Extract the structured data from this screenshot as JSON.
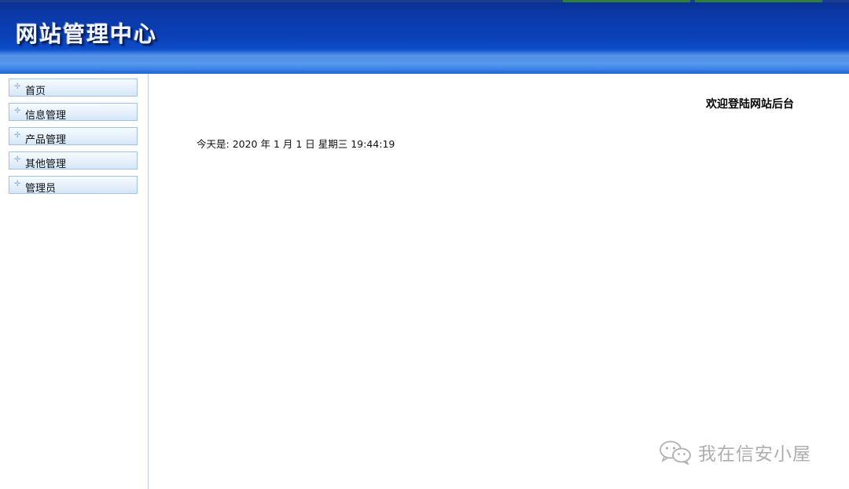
{
  "header": {
    "site_title": "网站管理中心"
  },
  "sidebar": {
    "items": [
      {
        "label": "首页",
        "icon": "plus-icon"
      },
      {
        "label": "信息管理",
        "icon": "plus-icon"
      },
      {
        "label": "产品管理",
        "icon": "plus-icon"
      },
      {
        "label": "其他管理",
        "icon": "plus-icon"
      },
      {
        "label": "管理员",
        "icon": "plus-icon"
      }
    ]
  },
  "main": {
    "welcome": "欢迎登陆网站后台",
    "date_label": "今天是:",
    "date_value": "2020 年 1 月 1 日 星期三 19:44:19"
  },
  "watermark": {
    "text": "我在信安小屋",
    "icon": "wechat-icon"
  },
  "colors": {
    "header_blue": "#0b3aa8",
    "menu_border": "#9ec3e6",
    "menu_bg": "#e5f0fb"
  }
}
